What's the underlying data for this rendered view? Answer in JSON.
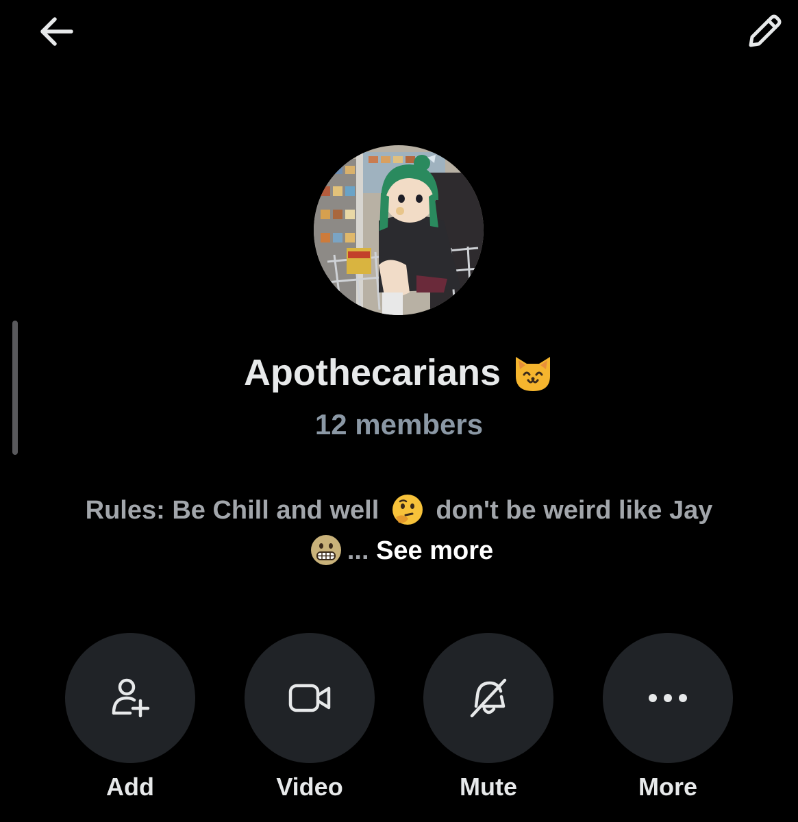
{
  "header": {
    "back_icon": "arrow-left-icon",
    "edit_icon": "pencil-icon"
  },
  "group": {
    "name": "Apothecarians",
    "name_emoji": "cat-face-emoji",
    "members": "12 members",
    "avatar": "anime-girl-shopping-cart-avatar"
  },
  "description": {
    "part1": "Rules: Be Chill and well",
    "emoji1": "thinking-face-emoji",
    "part2": "don't be weird like Jay",
    "emoji2": "grimacing-face-emoji",
    "ellipsis": "...",
    "see_more": "See more"
  },
  "actions": [
    {
      "label": "Add",
      "icon": "add-person-icon"
    },
    {
      "label": "Video",
      "icon": "video-camera-icon"
    },
    {
      "label": "Mute",
      "icon": "bell-off-icon"
    },
    {
      "label": "More",
      "icon": "more-dots-icon"
    }
  ],
  "colors": {
    "background": "#000000",
    "title": "#e7e9ea",
    "members": "#8b98a5",
    "description": "#a2a6ab",
    "see_more": "#ffffff",
    "action_circle": "#202327"
  }
}
